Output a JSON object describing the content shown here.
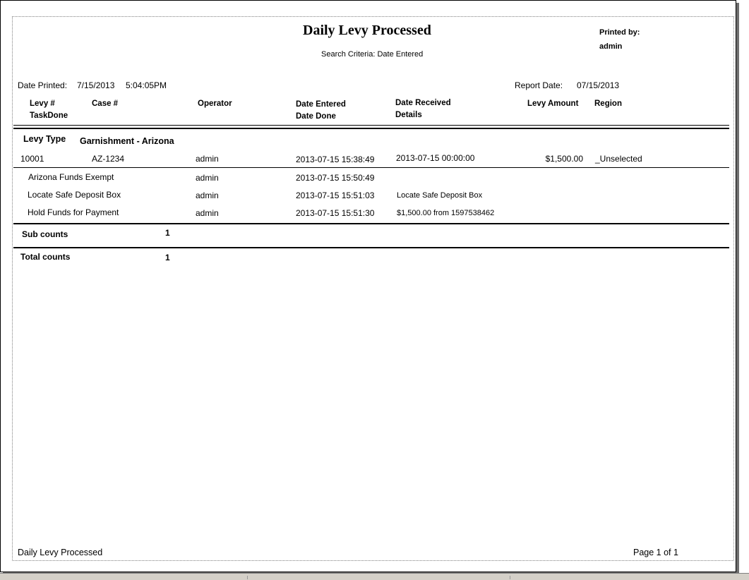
{
  "report": {
    "title": "Daily Levy Processed",
    "search_criteria": "Search Criteria: Date Entered",
    "printed_by_label": "Printed by:",
    "printed_by_value": "admin",
    "date_printed_label": "Date Printed:",
    "date_printed_value": "7/15/2013",
    "time_printed_value": "5:04:05PM",
    "report_date_label": "Report Date:",
    "report_date_value": "07/15/2013"
  },
  "columns": {
    "levy_no": "Levy #",
    "task_done": "TaskDone",
    "case_no": "Case #",
    "operator": "Operator",
    "date_entered": "Date Entered",
    "date_done": "Date Done",
    "date_received": "Date Received",
    "details": "Details",
    "levy_amount": "Levy Amount",
    "region": "Region"
  },
  "group": {
    "label": "Levy Type",
    "value": "Garnishment - Arizona"
  },
  "levy_row": {
    "levy_no": "10001",
    "case_no": "AZ-1234",
    "operator": "admin",
    "date_entered": "2013-07-15 15:38:49",
    "date_received": "2013-07-15 00:00:00",
    "levy_amount": "$1,500.00",
    "region": "_Unselected"
  },
  "tasks": [
    {
      "name": "Arizona Funds Exempt",
      "operator": "admin",
      "date_done": "2013-07-15 15:50:49",
      "details": ""
    },
    {
      "name": "Locate Safe Deposit Box",
      "operator": "admin",
      "date_done": "2013-07-15 15:51:03",
      "details": "Locate Safe Deposit Box"
    },
    {
      "name": "Hold Funds for Payment",
      "operator": "admin",
      "date_done": "2013-07-15 15:51:30",
      "details": "$1,500.00 from 1597538462"
    }
  ],
  "sub_counts": {
    "label": "Sub counts",
    "value": "1"
  },
  "total_counts": {
    "label": "Total counts",
    "value": "1"
  },
  "footer": {
    "left": "Daily Levy Processed",
    "page": "Page 1 of 1"
  }
}
